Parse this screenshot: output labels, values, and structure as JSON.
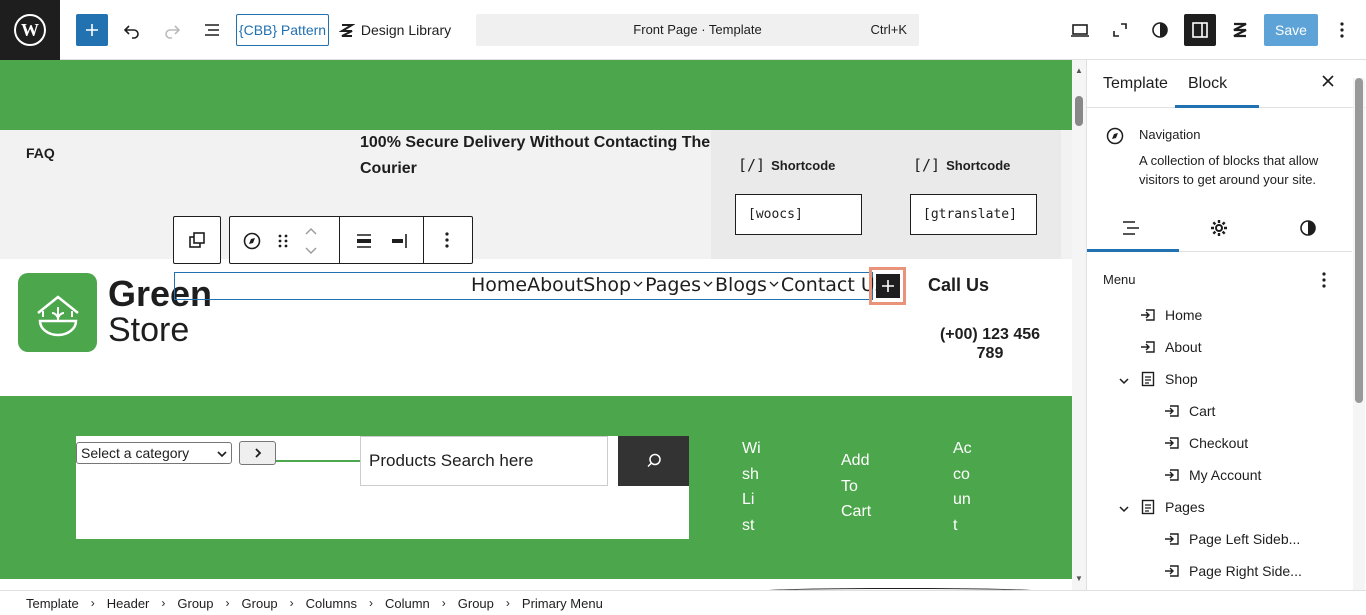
{
  "topbar": {
    "pattern_label": "{CBB} Pattern",
    "design_library_label": "Design Library",
    "command_title": "Front Page · Template",
    "command_shortcut": "Ctrl+K",
    "save_label": "Save"
  },
  "canvas": {
    "faq_label": "FAQ",
    "secure_delivery": "100% Secure Delivery Without Contacting The Courier",
    "shortcode_label_1": "Shortcode",
    "shortcode_label_2": "Shortcode",
    "shortcode_value_1": "[woocs]",
    "shortcode_value_2": "[gtranslate]",
    "logo_line1": "Green",
    "logo_line2": "Store",
    "nav": [
      "Home",
      "About",
      "Shop",
      "Pages",
      "Blogs",
      "Contact Us"
    ],
    "call_us": "Call Us",
    "phone": "(+00) 123 456 789",
    "category_select": "Select a category",
    "search_placeholder": "Products Search here",
    "wishlist": "Wi sh Li st",
    "add_to_cart": "Add To Cart",
    "account": "Ac co un t"
  },
  "panel": {
    "tab_template": "Template",
    "tab_block": "Block",
    "block_name": "Navigation",
    "block_description": "A collection of blocks that allow visitors to get around your site.",
    "menu_heading": "Menu",
    "menu_items": {
      "home": "Home",
      "about": "About",
      "shop": "Shop",
      "cart": "Cart",
      "checkout": "Checkout",
      "my_account": "My Account",
      "pages": "Pages",
      "page_left": "Page Left Sideb...",
      "page_right": "Page Right Side..."
    }
  },
  "breadcrumb": {
    "items": [
      "Template",
      "Header",
      "Group",
      "Group",
      "Columns",
      "Column",
      "Group",
      "Primary Menu"
    ]
  },
  "colors": {
    "accent": "#2271b1",
    "green": "#4ca64c",
    "dark": "#1e1e1e",
    "highlight": "#e8937a"
  }
}
